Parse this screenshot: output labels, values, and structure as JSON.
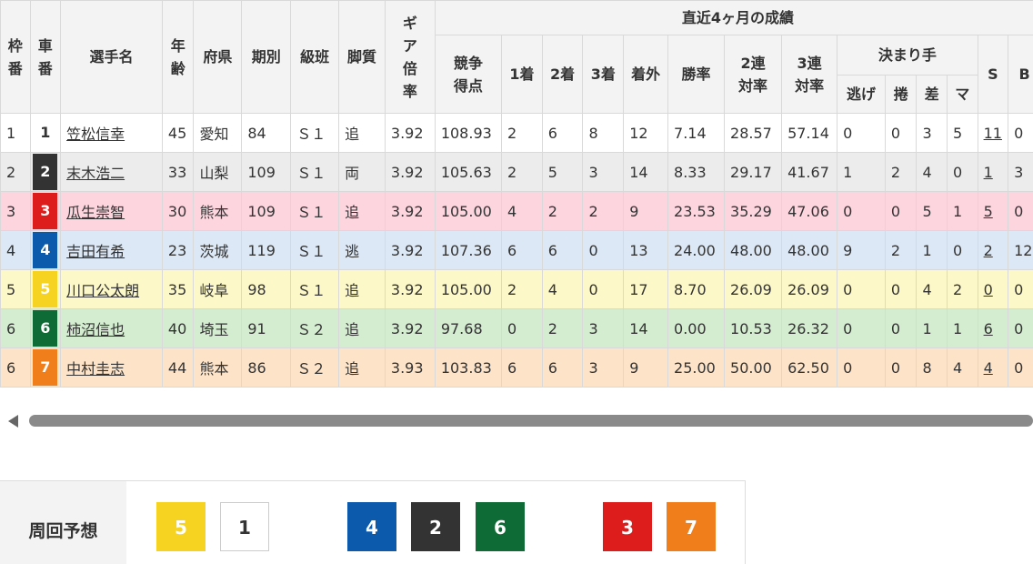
{
  "header": {
    "waku": "枠番",
    "sha": "車番",
    "name": "選手名",
    "age": "年齢",
    "pref": "府県",
    "term": "期別",
    "class": "級班",
    "style": "脚質",
    "gear": "ギア倍率",
    "recent": "直近4ヶ月の成績",
    "score": "競争得点",
    "first": "1着",
    "second": "2着",
    "third": "3着",
    "out": "着外",
    "winrate": "勝率",
    "rate2": "2連対率",
    "rate3": "3連対率",
    "kimarite": "決まり手",
    "nige": "逃げ",
    "makuri": "捲",
    "sashi": "差",
    "mark": "マ",
    "s": "S",
    "b": "B"
  },
  "riders": [
    {
      "waku": "1",
      "car": "1",
      "car_bg": "#ffffff",
      "car_fg": "#333333",
      "name": "笠松信幸",
      "age": "45",
      "pref": "愛知",
      "term": "84",
      "class": "Ｓ１",
      "style": "追",
      "gear": "3.92",
      "score": "108.93",
      "first": "2",
      "second": "6",
      "third": "8",
      "out": "12",
      "winrate": "7.14",
      "rate2": "28.57",
      "rate3": "57.14",
      "nige": "0",
      "makuri": "0",
      "sashi": "3",
      "mark": "5",
      "s": "11",
      "b": "0"
    },
    {
      "waku": "2",
      "car": "2",
      "car_bg": "#333333",
      "car_fg": "#ffffff",
      "name": "末木浩二",
      "age": "33",
      "pref": "山梨",
      "term": "109",
      "class": "Ｓ１",
      "style": "両",
      "gear": "3.92",
      "score": "105.63",
      "first": "2",
      "second": "5",
      "third": "3",
      "out": "14",
      "winrate": "8.33",
      "rate2": "29.17",
      "rate3": "41.67",
      "nige": "1",
      "makuri": "2",
      "sashi": "4",
      "mark": "0",
      "s": "1",
      "b": "3"
    },
    {
      "waku": "3",
      "car": "3",
      "car_bg": "#dd1c1c",
      "car_fg": "#ffffff",
      "name": "瓜生崇智",
      "age": "30",
      "pref": "熊本",
      "term": "109",
      "class": "Ｓ１",
      "style": "追",
      "gear": "3.92",
      "score": "105.00",
      "first": "4",
      "second": "2",
      "third": "2",
      "out": "9",
      "winrate": "23.53",
      "rate2": "35.29",
      "rate3": "47.06",
      "nige": "0",
      "makuri": "0",
      "sashi": "5",
      "mark": "1",
      "s": "5",
      "b": "0"
    },
    {
      "waku": "4",
      "car": "4",
      "car_bg": "#0b5aab",
      "car_fg": "#ffffff",
      "name": "吉田有希",
      "age": "23",
      "pref": "茨城",
      "term": "119",
      "class": "Ｓ１",
      "style": "逃",
      "gear": "3.92",
      "score": "107.36",
      "first": "6",
      "second": "6",
      "third": "0",
      "out": "13",
      "winrate": "24.00",
      "rate2": "48.00",
      "rate3": "48.00",
      "nige": "9",
      "makuri": "2",
      "sashi": "1",
      "mark": "0",
      "s": "2",
      "b": "12"
    },
    {
      "waku": "5",
      "car": "5",
      "car_bg": "#f6d320",
      "car_fg": "#ffffff",
      "name": "川口公太朗",
      "age": "35",
      "pref": "岐阜",
      "term": "98",
      "class": "Ｓ１",
      "style": "追",
      "gear": "3.92",
      "score": "105.00",
      "first": "2",
      "second": "4",
      "third": "0",
      "out": "17",
      "winrate": "8.70",
      "rate2": "26.09",
      "rate3": "26.09",
      "nige": "0",
      "makuri": "0",
      "sashi": "4",
      "mark": "2",
      "s": "0",
      "b": "0"
    },
    {
      "waku": "6",
      "car": "6",
      "car_bg": "#0f6b35",
      "car_fg": "#ffffff",
      "name": "柿沼信也",
      "age": "40",
      "pref": "埼玉",
      "term": "91",
      "class": "Ｓ２",
      "style": "追",
      "gear": "3.92",
      "score": "97.68",
      "first": "0",
      "second": "2",
      "third": "3",
      "out": "14",
      "winrate": "0.00",
      "rate2": "10.53",
      "rate3": "26.32",
      "nige": "0",
      "makuri": "0",
      "sashi": "1",
      "mark": "1",
      "s": "6",
      "b": "0"
    },
    {
      "waku": "6",
      "car": "7",
      "car_bg": "#f07f1b",
      "car_fg": "#ffffff",
      "name": "中村圭志",
      "age": "44",
      "pref": "熊本",
      "term": "86",
      "class": "Ｓ２",
      "style": "追",
      "gear": "3.93",
      "score": "103.83",
      "first": "6",
      "second": "6",
      "third": "3",
      "out": "9",
      "winrate": "25.00",
      "rate2": "50.00",
      "rate3": "62.50",
      "nige": "0",
      "makuri": "0",
      "sashi": "8",
      "mark": "4",
      "s": "4",
      "b": "0"
    }
  ],
  "prediction": {
    "label": "周回予想",
    "boxes": [
      {
        "num": "5",
        "bg": "#f6d320",
        "fg": "#ffffff"
      },
      {
        "num": "1",
        "bg": "#ffffff",
        "fg": "#333333"
      },
      {
        "num": "4",
        "bg": "#0b5aab",
        "fg": "#ffffff"
      },
      {
        "num": "2",
        "bg": "#333333",
        "fg": "#ffffff"
      },
      {
        "num": "6",
        "bg": "#0f6b35",
        "fg": "#ffffff"
      },
      {
        "num": "3",
        "bg": "#dd1c1c",
        "fg": "#ffffff"
      },
      {
        "num": "7",
        "bg": "#f07f1b",
        "fg": "#ffffff"
      }
    ]
  }
}
